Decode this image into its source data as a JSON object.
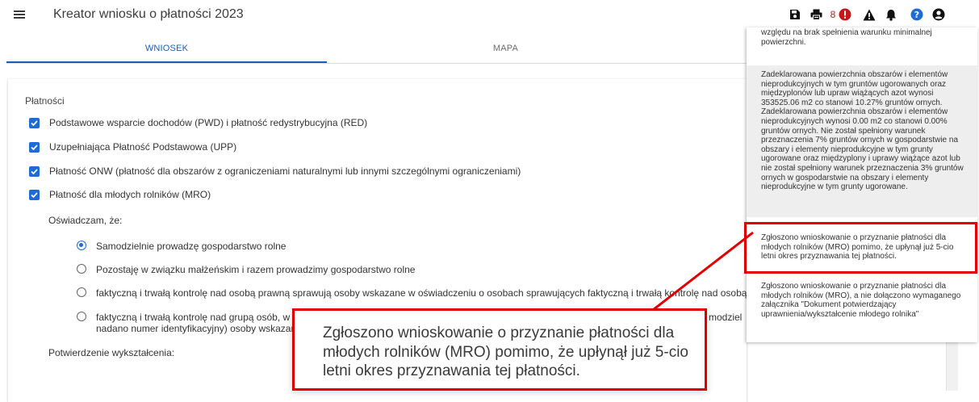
{
  "app": {
    "title": "Kreator wniosku o płatności 2023"
  },
  "toolbar": {
    "badge_count": "8",
    "icons": [
      "save-icon",
      "print-icon",
      "error-icon",
      "warning-icon",
      "bell-icon",
      "help-icon",
      "account-icon"
    ]
  },
  "tabs": [
    {
      "label": "WNIOSEK",
      "active": true
    },
    {
      "label": "MAPA",
      "active": false
    }
  ],
  "payments": {
    "section_label": "Płatności",
    "items": [
      {
        "label": "Podstawowe wsparcie dochodów (PWD) i płatność redystrybucyjna (RED)",
        "checked": true
      },
      {
        "label": "Uzupełniająca Płatność Podstawowa (UPP)",
        "checked": true
      },
      {
        "label": "Płatność ONW (płatność dla obszarów z ograniczeniami naturalnymi lub innymi szczególnymi ograniczeniami)",
        "checked": true
      },
      {
        "label": "Płatność dla młodych rolników (MRO)",
        "checked": true
      }
    ]
  },
  "declaration": {
    "label": "Oświadczam, że:",
    "options": [
      {
        "label": "Samodzielnie prowadzę gospodarstwo rolne",
        "selected": true
      },
      {
        "label": "Pozostaję w związku małżeńskim i razem prowadzimy gospodarstwo rolne",
        "selected": false
      },
      {
        "label": "faktyczną i trwałą kontrolę nad osobą prawną sprawują osoby wskazane w oświadczeniu o osobach sprawujących faktyczną i trwałą kontrolę nad osobą prawną",
        "selected": false
      },
      {
        "label": "faktyczną i trwałą kontrolę nad grupą osób, w ty",
        "label_end": "modziel",
        "label_line2": "nadano numer identyfikacyjny) osoby wskazane",
        "selected": false
      }
    ]
  },
  "education": {
    "label": "Potwierdzenie wykształcenia:"
  },
  "messages": [
    {
      "text": "względu na brak spełnienia warunku minimalnej powierzchni."
    },
    {
      "text": "Zadeklarowana powierzchnia obszarów i elementów nieprodukcyjnych w tym gruntów ugorowanych oraz międzyplonów lub upraw wiążących azot wynosi 353525.06 m2 co stanowi 10.27% gruntów ornych. Zadeklarowana powierzchnia obszarów i elementów nieprodukcyjnych wynosi 0.00 m2 co stanowi 0.00% gruntów ornych. Nie został spełniony warunek przeznaczenia 7% gruntów ornych w gospodarstwie na obszary i elementy nieprodukcyjne w tym grunty ugorowane oraz międzyplony i uprawy wiążące azot lub nie został spełniony warunek przeznaczenia 3% gruntów ornych w gospodarstwie na obszary i elementy nieprodukcyjne w tym grunty ugorowane."
    },
    {
      "text": "Zgłoszono wnioskowanie o przyznanie płatności dla młodych rolników (MRO) pomimo, że upłynął już 5-cio letni okres przyznawania tej płatności."
    },
    {
      "text": "Zgłoszono wnioskowanie o przyznanie płatności dla młodych rolników (MRO), a nie dołączono wymaganego załącznika \"Dokument potwierdzający uprawnienia/wykształcenie młodego rolnika\""
    }
  ],
  "callout": {
    "text": "Zgłoszono wnioskowanie o przyznanie płatności dla młodych rolników (MRO) pomimo, że upłynął już 5-cio letni okres przyznawania tej płatności."
  },
  "colors": {
    "accent": "#1a5fb4",
    "checkbox": "#1e6bd6",
    "error": "#c4161c",
    "highlight": "#e00000",
    "message_bg": "#eeeeee"
  }
}
